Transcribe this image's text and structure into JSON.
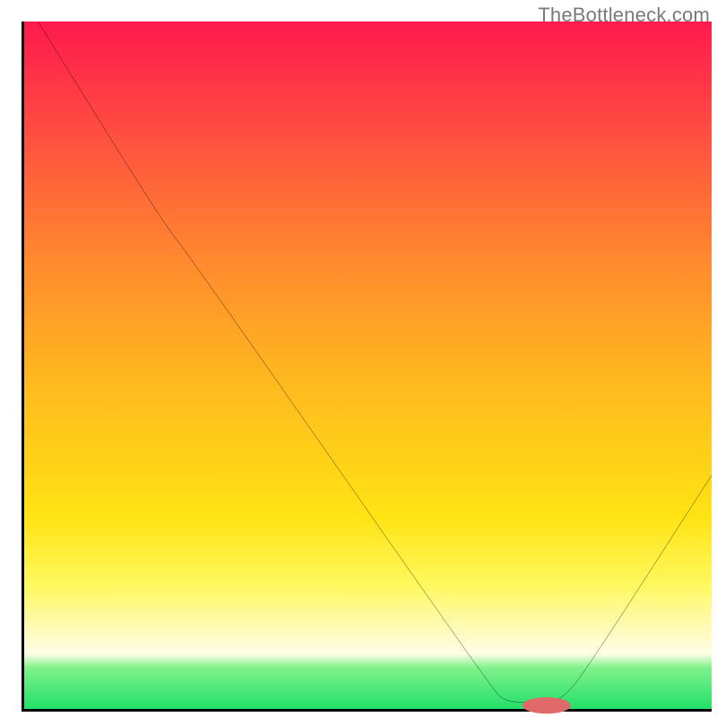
{
  "watermark": "TheBottleneck.com",
  "chart_data": {
    "type": "line",
    "title": "",
    "xlabel": "",
    "ylabel": "",
    "xlim": [
      0,
      100
    ],
    "ylim": [
      0,
      100
    ],
    "grid": false,
    "axes_visible": {
      "left": true,
      "bottom": true,
      "ticks": false
    },
    "background_gradient_stops": [
      {
        "pos": 0,
        "color": "#ff1a4d"
      },
      {
        "pos": 8,
        "color": "#ff3347"
      },
      {
        "pos": 20,
        "color": "#ff5a3d"
      },
      {
        "pos": 35,
        "color": "#ff8a2e"
      },
      {
        "pos": 52,
        "color": "#ffb81f"
      },
      {
        "pos": 72,
        "color": "#ffe313"
      },
      {
        "pos": 82,
        "color": "#fff85f"
      },
      {
        "pos": 90,
        "color": "#fffccf"
      },
      {
        "pos": 92,
        "color": "#fffde6"
      },
      {
        "pos": 94,
        "color": "#80f28a"
      },
      {
        "pos": 100,
        "color": "#22e06a"
      }
    ],
    "curve_xy": [
      {
        "x": 2,
        "y": 100
      },
      {
        "x": 20,
        "y": 71
      },
      {
        "x": 24,
        "y": 66
      },
      {
        "x": 68,
        "y": 3
      },
      {
        "x": 70,
        "y": 1
      },
      {
        "x": 74,
        "y": 1
      },
      {
        "x": 78,
        "y": 1
      },
      {
        "x": 82,
        "y": 6
      },
      {
        "x": 100,
        "y": 34
      }
    ],
    "marker": {
      "x": 76,
      "y": 0.5,
      "color": "#e06a6a",
      "rx": 3.5,
      "ry": 1.2
    }
  }
}
